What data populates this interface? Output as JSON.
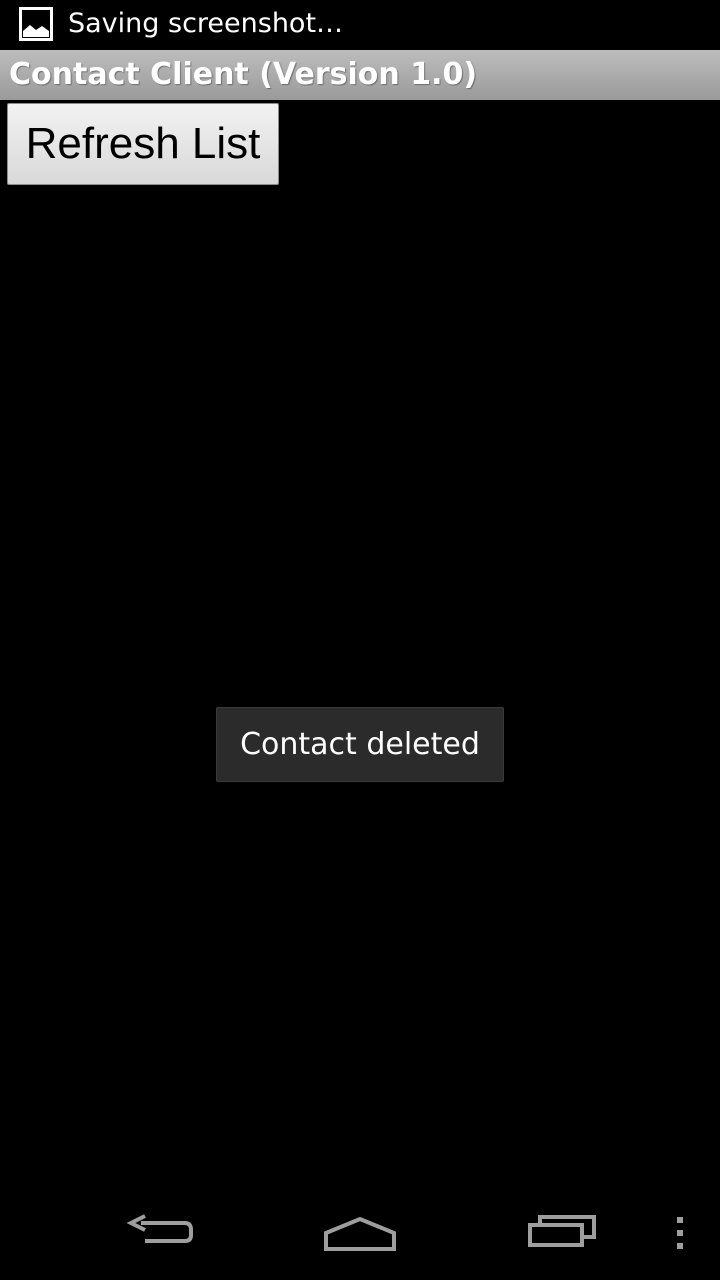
{
  "status_bar": {
    "notification_icon": "picture-icon",
    "notification_text": "Saving screenshot…"
  },
  "title_bar": {
    "title": "Contact Client (Version 1.0)"
  },
  "main": {
    "refresh_button_label": "Refresh List"
  },
  "toast": {
    "message": "Contact deleted"
  },
  "nav_bar": {
    "back_icon": "back-arrow-icon",
    "home_icon": "home-icon",
    "recents_icon": "recent-apps-icon",
    "menu_icon": "overflow-menu-icon"
  },
  "colors": {
    "background": "#000000",
    "title_bar": "#a8a8a8",
    "toast_background": "#2b2b2b",
    "button_background": "#e6e6e6"
  }
}
